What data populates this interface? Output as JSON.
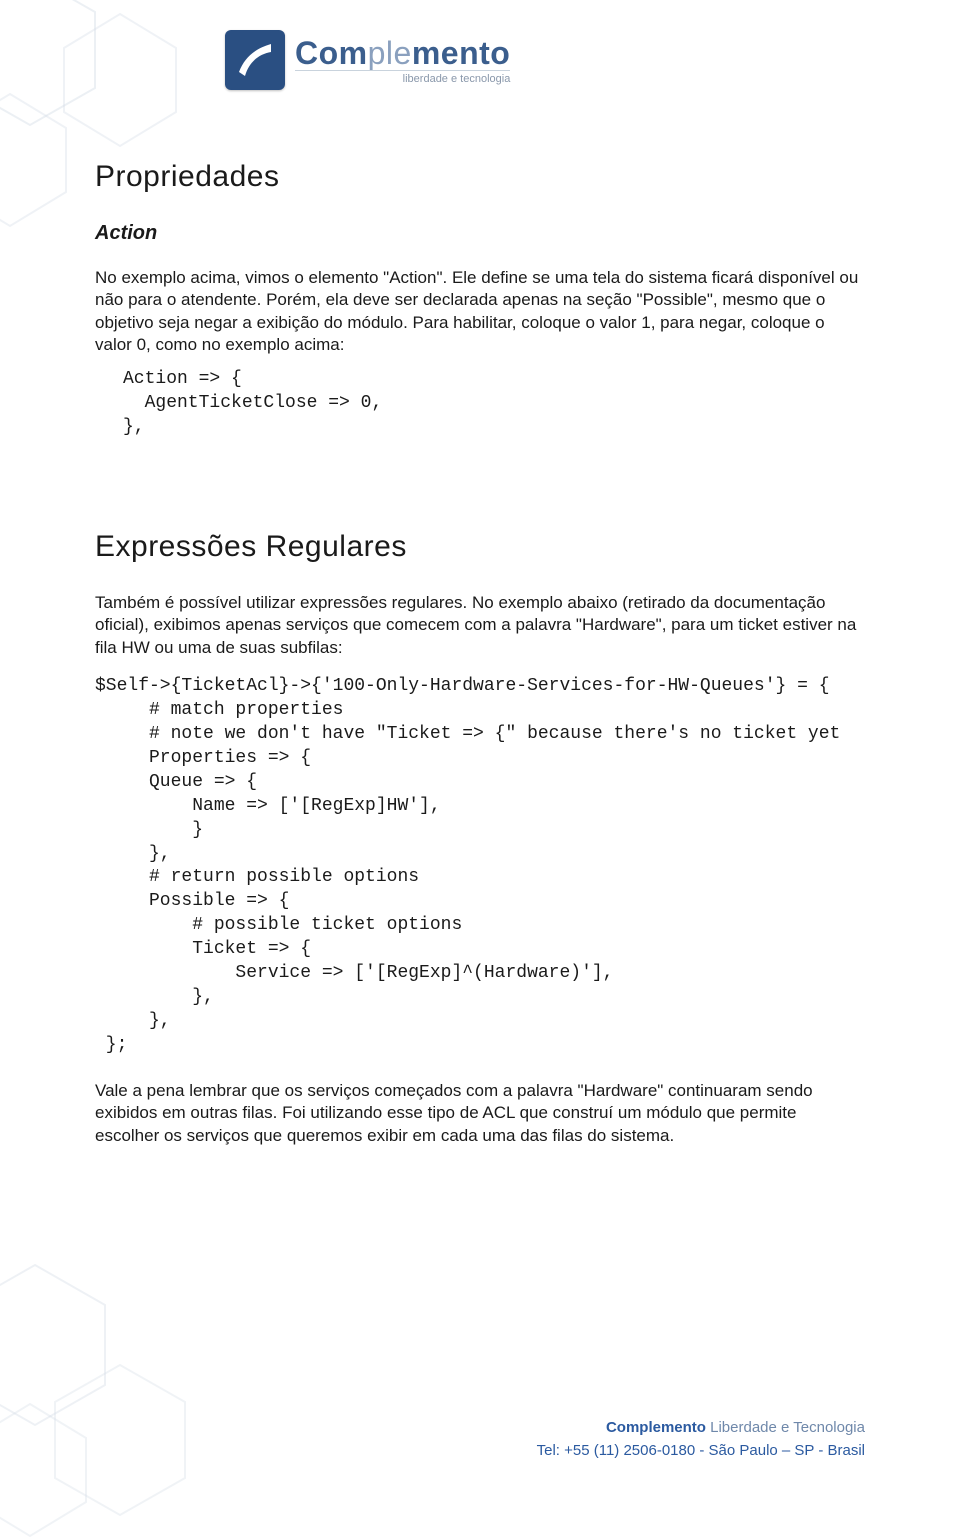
{
  "logo": {
    "name": "Complemento",
    "tagline": "liberdade e tecnologia"
  },
  "h1_propriedades": "Propriedades",
  "h2_action": "Action",
  "p_action": "No exemplo acima, vimos o elemento \"Action\". Ele define se uma tela do sistema ficará disponível ou não para o atendente. Porém, ela deve ser declarada apenas na seção \"Possible\", mesmo que o objetivo seja negar a exibição do módulo. Para habilitar, coloque o valor 1, para negar, coloque o valor 0, como no exemplo acima:",
  "code_action": "Action => {\n  AgentTicketClose => 0,\n},",
  "h1_regex": "Expressões Regulares",
  "p_regex": "Também é possível utilizar expressões regulares. No exemplo abaixo (retirado da documentação oficial), exibimos apenas serviços que comecem com a palavra \"Hardware\", para um ticket estiver na fila HW ou uma de suas subfilas:",
  "code_regex": "$Self->{TicketAcl}->{'100-Only-Hardware-Services-for-HW-Queues'} = {\n     # match properties\n     # note we don't have \"Ticket => {\" because there's no ticket yet\n     Properties => {\n     Queue => {\n         Name => ['[RegExp]HW'],\n         }\n     },\n     # return possible options\n     Possible => {\n         # possible ticket options\n         Ticket => {\n             Service => ['[RegExp]^(Hardware)'],\n         },\n     },\n };",
  "p_closing": "Vale a pena lembrar que os serviços começados com a palavra \"Hardware\" continuaram sendo exibidos em outras filas. Foi utilizando esse tipo de ACL que construí um módulo que permite escolher os serviços que queremos exibir em cada uma das filas do sistema.",
  "footer": {
    "brand_bold": "Complemento",
    "brand_light": " Liberdade e Tecnologia",
    "contact": "Tel: +55 (11) 2506-0180 - São Paulo – SP - Brasil"
  }
}
